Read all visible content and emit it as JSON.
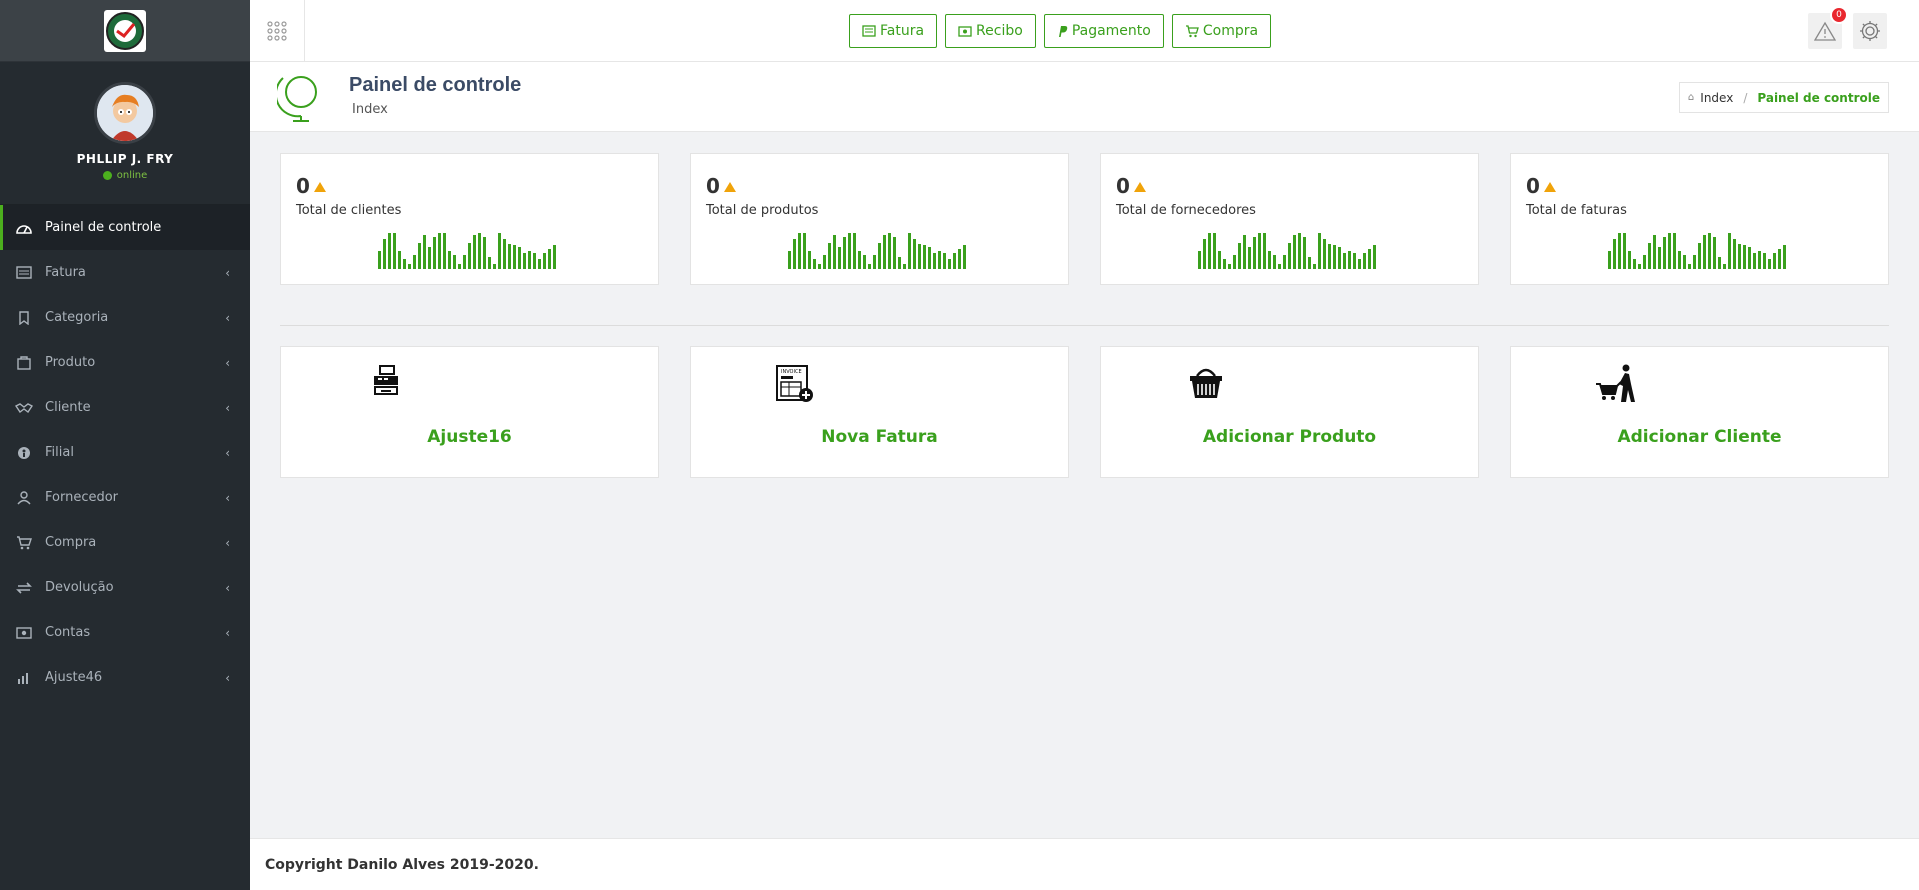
{
  "sidebar": {
    "user": {
      "name": "PHLLIP J. FRY",
      "status": "online"
    },
    "items": [
      {
        "label": "Painel de controle",
        "icon": "dashboard-icon",
        "active": true
      },
      {
        "label": "Fatura",
        "icon": "invoice-icon"
      },
      {
        "label": "Categoria",
        "icon": "tag-icon"
      },
      {
        "label": "Produto",
        "icon": "box-icon"
      },
      {
        "label": "Cliente",
        "icon": "handshake-icon"
      },
      {
        "label": "Filial",
        "icon": "branch-icon"
      },
      {
        "label": "Fornecedor",
        "icon": "user-icon"
      },
      {
        "label": "Compra",
        "icon": "cart-icon"
      },
      {
        "label": "Devolução",
        "icon": "return-icon"
      },
      {
        "label": "Contas",
        "icon": "money-icon"
      },
      {
        "label": "Ajuste46",
        "icon": "bar-chart-icon"
      }
    ]
  },
  "topbar": {
    "quick_buttons": [
      {
        "label": "Fatura",
        "icon": "invoice-icon"
      },
      {
        "label": "Recibo",
        "icon": "money-icon"
      },
      {
        "label": "Pagamento",
        "icon": "paypal-icon"
      },
      {
        "label": "Compra",
        "icon": "cart-icon"
      }
    ],
    "alerts_count": "0"
  },
  "header": {
    "title": "Painel de controle",
    "subtitle": "Index",
    "breadcrumb": {
      "home": "Index",
      "current": "Painel de controle"
    }
  },
  "stats": [
    {
      "value": "0",
      "label": "Total de clientes"
    },
    {
      "value": "0",
      "label": "Total de produtos"
    },
    {
      "value": "0",
      "label": "Total de fornecedores"
    },
    {
      "value": "0",
      "label": "Total de faturas"
    }
  ],
  "sparkline_values": [
    18,
    30,
    36,
    36,
    18,
    10,
    5,
    14,
    26,
    34,
    22,
    32,
    36,
    36,
    18,
    14,
    5,
    14,
    26,
    34,
    36,
    32,
    12,
    5,
    36,
    30,
    25,
    24,
    22,
    16,
    18,
    16,
    10,
    16,
    20,
    24
  ],
  "actions": [
    {
      "label": "Ajuste16",
      "icon": "cash-register-icon"
    },
    {
      "label": "Nova Fatura",
      "icon": "new-invoice-icon"
    },
    {
      "label": "Adicionar Produto",
      "icon": "basket-icon"
    },
    {
      "label": "Adicionar Cliente",
      "icon": "shopper-icon"
    }
  ],
  "footer": {
    "text": "Copyright Danilo Alves 2019-2020."
  },
  "colors": {
    "accent": "#3aa01d",
    "sidebar": "#252b30",
    "warning": "#f0a30a",
    "badge": "#e9282f"
  }
}
